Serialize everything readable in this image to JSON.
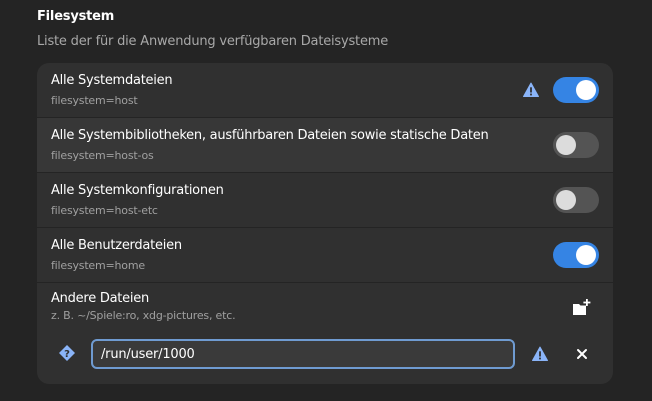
{
  "section": {
    "title": "Filesystem",
    "subtitle": "Liste der für die Anwendung verfügbaren Dateisysteme"
  },
  "rows": [
    {
      "title": "Alle Systemdateien",
      "subtitle": "filesystem=host",
      "enabled": true,
      "warning": true
    },
    {
      "title": "Alle Systembibliotheken, ausführbaren Dateien sowie statische Daten",
      "subtitle": "filesystem=host-os",
      "enabled": false
    },
    {
      "title": "Alle Systemkonfigurationen",
      "subtitle": "filesystem=host-etc",
      "enabled": false
    },
    {
      "title": "Alle Benutzerdateien",
      "subtitle": "filesystem=home",
      "enabled": true
    }
  ],
  "other": {
    "title": "Andere Dateien",
    "subtitle": "z. B. ~/Spiele:ro, xdg-pictures, etc.",
    "path_value": "/run/user/1000"
  },
  "icons": {
    "warning": "warning-icon",
    "add": "folder-new-icon",
    "help": "help-icon",
    "close": "close-icon"
  },
  "colors": {
    "accent": "#3584e4",
    "background": "#242424",
    "card": "#303030",
    "warning_icon": "#8ab4f8"
  }
}
